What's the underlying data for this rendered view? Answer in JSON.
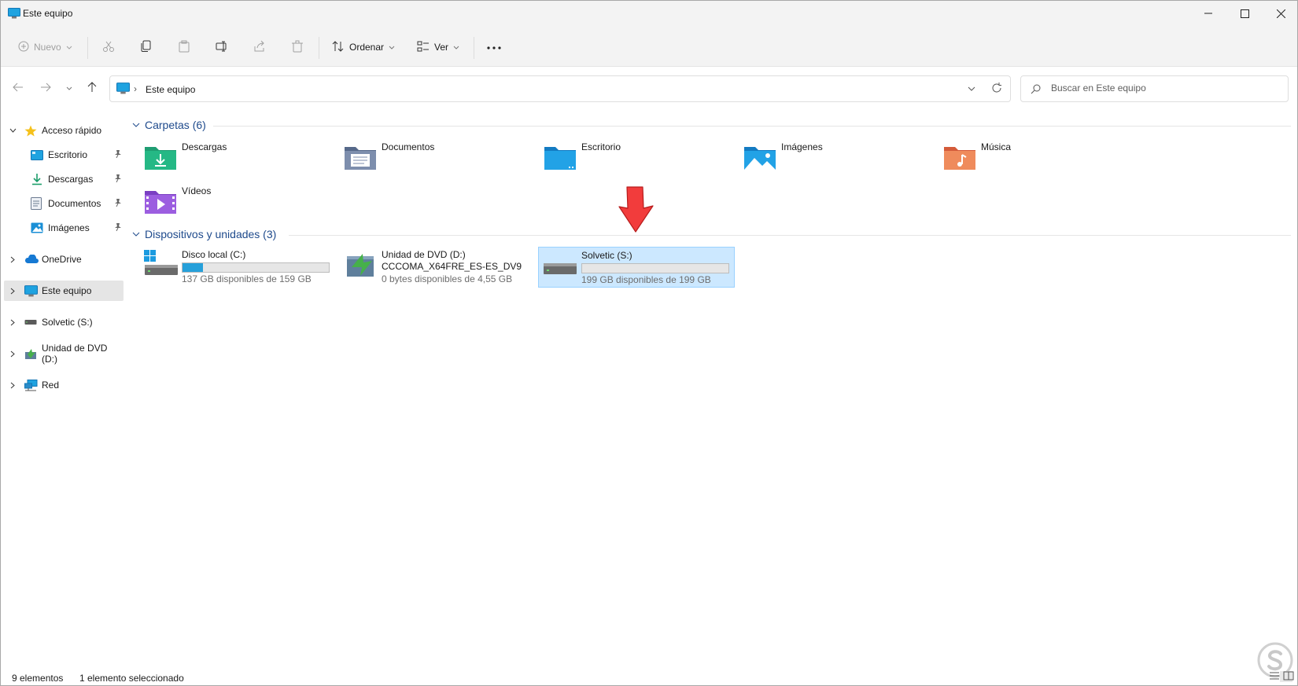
{
  "window": {
    "title": "Este equipo"
  },
  "toolbar": {
    "new_label": "Nuevo",
    "sort_label": "Ordenar",
    "view_label": "Ver",
    "icons": [
      "plus-icon",
      "cut-icon",
      "copy-icon",
      "paste-icon",
      "rename-icon",
      "share-icon",
      "delete-icon",
      "sort-icon",
      "view-icon",
      "more-icon"
    ]
  },
  "address": {
    "crumb": "Este equipo"
  },
  "search": {
    "placeholder": "Buscar en Este equipo"
  },
  "nav": {
    "quick_access": "Acceso rápido",
    "quick_items": [
      {
        "label": "Escritorio",
        "icon": "desktop-icon"
      },
      {
        "label": "Descargas",
        "icon": "download-icon"
      },
      {
        "label": "Documentos",
        "icon": "document-icon"
      },
      {
        "label": "Imágenes",
        "icon": "image-icon"
      }
    ],
    "onedrive": "OneDrive",
    "this_pc": "Este equipo",
    "solvetic": "Solvetic (S:)",
    "dvd": "Unidad de DVD (D:)",
    "network": "Red"
  },
  "content": {
    "folders_header": "Carpetas (6)",
    "folders": [
      "Descargas",
      "Documentos",
      "Escritorio",
      "Imágenes",
      "Música",
      "Vídeos"
    ],
    "devices_header": "Dispositivos y unidades (3)",
    "drives": [
      {
        "name": "Disco local (C:)",
        "free": "137 GB disponibles de 159 GB",
        "used_fraction": 0.14
      },
      {
        "name": "Unidad de DVD (D:)",
        "sub": "CCCOMA_X64FRE_ES-ES_DV9",
        "free": "0 bytes disponibles de 4,55 GB"
      },
      {
        "name": "Solvetic (S:)",
        "free": "199 GB disponibles de 199 GB",
        "used_fraction": 0.0
      }
    ]
  },
  "status": {
    "count": "9 elementos",
    "selection": "1 elemento seleccionado"
  },
  "colors": {
    "accent": "#26a0da",
    "selection": "#cce8ff",
    "header_blue": "#1e4a8c",
    "annotation_red": "#f23c3c"
  }
}
